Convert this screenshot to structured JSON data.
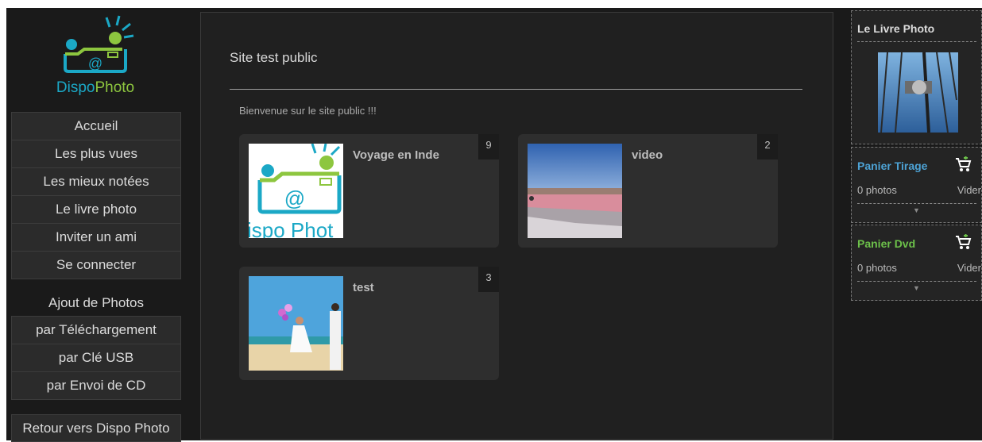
{
  "logo": {
    "brand_part1": "Dispo",
    "brand_part2": "Photo",
    "icon_text": "@"
  },
  "nav": {
    "items": [
      "Accueil",
      "Les plus vues",
      "Les mieux notées",
      "Le livre photo",
      "Inviter un ami",
      "Se connecter"
    ],
    "upload_heading": "Ajout de Photos",
    "upload_items": [
      "par Téléchargement",
      "par Clé USB",
      "par Envoi de CD"
    ],
    "back": "Retour vers Dispo Photo"
  },
  "main": {
    "title": "Site test public",
    "welcome": "Bienvenue sur le site public !!!",
    "albums": [
      {
        "title": "Voyage en Inde",
        "count": "9",
        "thumb_text": "ispo Phot"
      },
      {
        "title": "video",
        "count": "2"
      },
      {
        "title": "test",
        "count": "3"
      }
    ]
  },
  "right": {
    "livre": {
      "title": "Le Livre Photo"
    },
    "panier_tirage": {
      "title": "Panier Tirage",
      "photos": "0 photos",
      "vider": "Vider",
      "color": "#4da3d6"
    },
    "panier_dvd": {
      "title": "Panier Dvd",
      "photos": "0 photos",
      "vider": "Vider",
      "color": "#6cc04a"
    }
  },
  "colors": {
    "background": "#1a1a1a",
    "panel": "#202020",
    "card": "#2e2e2e",
    "brand_blue": "#1ba8c6",
    "brand_green": "#8dc63f"
  }
}
